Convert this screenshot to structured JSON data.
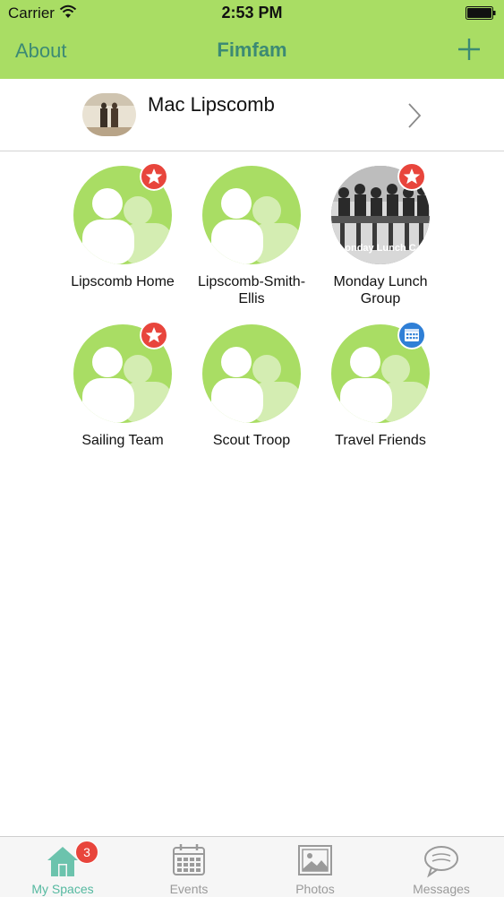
{
  "status_bar": {
    "carrier": "Carrier",
    "time": "2:53 PM"
  },
  "nav": {
    "left_label": "About",
    "title": "Fimfam",
    "right_icon": "plus-icon"
  },
  "profile": {
    "name": "Mac Lipscomb"
  },
  "spaces": [
    {
      "label": "Lipscomb Home",
      "badge": "star"
    },
    {
      "label": "Lipscomb-Smith-Ellis",
      "badge": ""
    },
    {
      "label": "Monday Lunch Group",
      "badge": "star",
      "photo_text": "onday Lunch C"
    },
    {
      "label": "Sailing Team",
      "badge": "star"
    },
    {
      "label": "Scout Troop",
      "badge": ""
    },
    {
      "label": "Travel Friends",
      "badge": "calendar"
    }
  ],
  "tabs": [
    {
      "label": "My Spaces",
      "icon": "home-icon",
      "badge": "3",
      "active": true
    },
    {
      "label": "Events",
      "icon": "calendar-icon"
    },
    {
      "label": "Photos",
      "icon": "photo-icon"
    },
    {
      "label": "Messages",
      "icon": "chat-icon"
    }
  ],
  "colors": {
    "accent_green": "#a9dd64",
    "nav_text": "#3c8a74",
    "star_badge": "#e8453c",
    "calendar_badge": "#2f7fd6",
    "active_tab": "#55b9a0"
  }
}
